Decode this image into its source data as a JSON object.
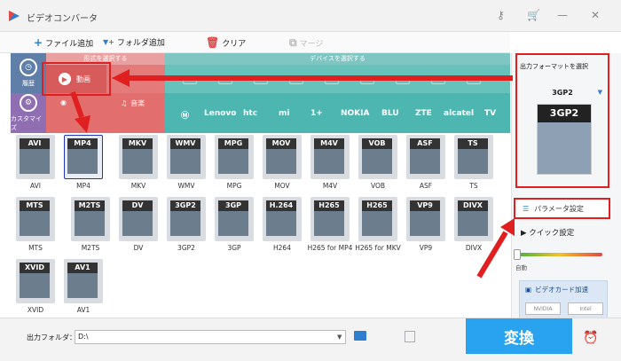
{
  "window": {
    "title": "ビデオコンバータ"
  },
  "toolbar": {
    "add_file": "ファイル追加",
    "add_folder": "フォルダ追加",
    "clear": "クリア",
    "merge": "マージ"
  },
  "categories": {
    "history": "履歴",
    "custom": "カスタマイズ",
    "format_header": "形式を選択する",
    "device_header": "デバイスを選択する",
    "video": "動画",
    "audio": "音楽",
    "brands": [
      "Lenovo",
      "htc",
      "mi",
      "1+",
      "NOKIA",
      "BLU",
      "ZTE",
      "alcatel",
      "TV"
    ]
  },
  "formats": [
    {
      "label": "AVI",
      "tag": "AVI"
    },
    {
      "label": "MP4",
      "tag": "MP4"
    },
    {
      "label": "MKV",
      "tag": "MKV"
    },
    {
      "label": "WMV",
      "tag": "WMV"
    },
    {
      "label": "MPG",
      "tag": "MPG"
    },
    {
      "label": "MOV",
      "tag": "MOV"
    },
    {
      "label": "M4V",
      "tag": "M4V"
    },
    {
      "label": "VOB",
      "tag": "VOB"
    },
    {
      "label": "ASF",
      "tag": "ASF"
    },
    {
      "label": "TS",
      "tag": "TS"
    },
    {
      "label": "MTS",
      "tag": "MTS"
    },
    {
      "label": "M2TS",
      "tag": "M2TS"
    },
    {
      "label": "DV",
      "tag": "DV"
    },
    {
      "label": "3GP2",
      "tag": "3GP2"
    },
    {
      "label": "3GP",
      "tag": "3GP"
    },
    {
      "label": "H264",
      "tag": "H.264"
    },
    {
      "label": "H265 for MP4",
      "tag": "H265"
    },
    {
      "label": "H265 for MKV",
      "tag": "H265"
    },
    {
      "label": "VP9",
      "tag": "VP9"
    },
    {
      "label": "DIVX",
      "tag": "DIVX"
    },
    {
      "label": "XVID",
      "tag": "XVID"
    },
    {
      "label": "AV1",
      "tag": "AV1"
    }
  ],
  "output": {
    "title": "出力フォーマットを選択",
    "format": "3GP2"
  },
  "settings": {
    "param": "パラメータ設定",
    "quick": "クイック設定",
    "auto": "自動",
    "gpu": "ビデオカード加速",
    "nvidia": "NVIDIA",
    "intel": "Intel"
  },
  "bottom": {
    "folder_label": "出力フォルダ：",
    "folder_value": "D:\\",
    "convert": "変換"
  }
}
